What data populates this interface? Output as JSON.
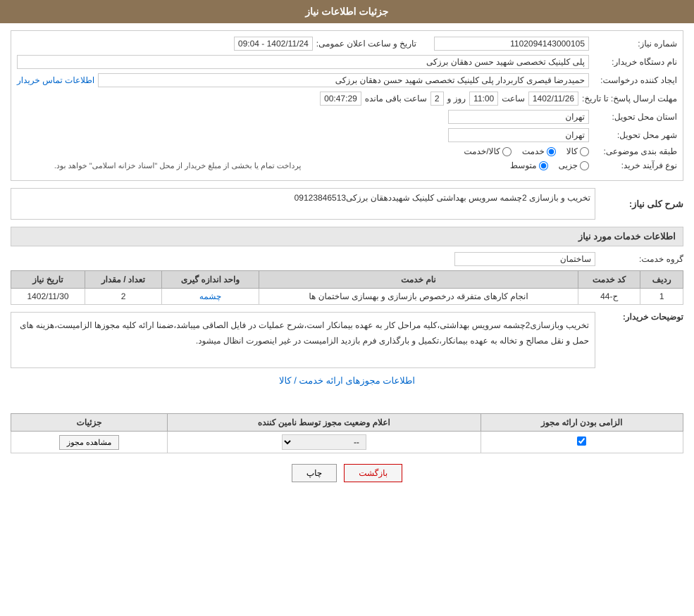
{
  "header": {
    "title": "جزئیات اطلاعات نیاز"
  },
  "need_info": {
    "need_number_label": "شماره نیاز:",
    "need_number_value": "1102094143000105",
    "org_name_label": "نام دستگاه خریدار:",
    "org_name_value": "پلی کلینیک تخصصی شهید حسن دهقان برزکی",
    "creator_label": "ایجاد کننده درخواست:",
    "creator_value": "حمیدرضا قیصری کاربردار پلی کلینیک تخصصی شهید حسن دهقان برزکی",
    "contact_link": "اطلاعات تماس خریدار",
    "deadline_label": "مهلت ارسال پاسخ: تا تاریخ:",
    "deadline_date": "1402/11/26",
    "deadline_time_label": "ساعت",
    "deadline_time": "11:00",
    "deadline_days_label": "روز و",
    "deadline_days": "2",
    "deadline_remaining_label": "ساعت باقی مانده",
    "deadline_remaining": "00:47:29",
    "announce_label": "تاریخ و ساعت اعلان عمومی:",
    "announce_value": "1402/11/24 - 09:04",
    "province_label": "استان محل تحویل:",
    "province_value": "تهران",
    "city_label": "شهر محل تحویل:",
    "city_value": "تهران",
    "category_label": "طبقه بندی موضوعی:",
    "category_options": [
      "کالا",
      "خدمت",
      "کالا/خدمت"
    ],
    "category_selected": "خدمت",
    "purchase_type_label": "نوع فرآیند خرید:",
    "purchase_options": [
      "جزیی",
      "متوسط"
    ],
    "purchase_note": "پرداخت تمام یا بخشی از مبلغ خریدار از محل \"اسناد خزانه اسلامی\" خواهد بود."
  },
  "need_description": {
    "section_title": "شرح کلی نیاز:",
    "description": "تخریب و بازسازی 2چشمه سرویس بهداشتی کلینیک شهیددهقان برزکی09123846513"
  },
  "services_section": {
    "section_title": "اطلاعات خدمات مورد نیاز",
    "service_group_label": "گروه خدمت:",
    "service_group_value": "ساختمان",
    "table_headers": {
      "row_num": "ردیف",
      "service_code": "کد خدمت",
      "service_name": "نام خدمت",
      "unit": "واحد اندازه گیری",
      "quantity": "تعداد / مقدار",
      "need_date": "تاریخ نیاز"
    },
    "table_rows": [
      {
        "row_num": "1",
        "service_code": "ح-44",
        "service_name": "انجام کارهای متفرقه درخصوص بازسازی و بهسازی ساختمان ها",
        "unit": "چشمه",
        "quantity": "2",
        "need_date": "1402/11/30"
      }
    ]
  },
  "buyer_notes": {
    "label": "توضیحات خریدار:",
    "text": "تخریب وبازسازی2چشمه سرویس بهداشتی،کلیه مراحل کار به عهده بیمانکار است،شرح عملیات در فایل الصاقی میباشد،ضمنا ارائه کلیه مجوزها الزامیست،هزینه های حمل و نقل مصالح و تخاله به عهده بیمانکار،تکمیل و بارگذاری فرم بازدید الزامیست در غیر اینصورت انظال میشود."
  },
  "permits_section": {
    "title": "اطلاعات مجوزهای ارائه خدمت / کالا",
    "table_headers": {
      "required": "الزامی بودن ارائه مجوز",
      "status": "اعلام وضعیت مجوز توسط نامین کننده",
      "details": "جزئیات"
    },
    "table_rows": [
      {
        "required": true,
        "status": "--",
        "details": "مشاهده مجوز"
      }
    ]
  },
  "buttons": {
    "print": "چاپ",
    "back": "بازگشت"
  }
}
